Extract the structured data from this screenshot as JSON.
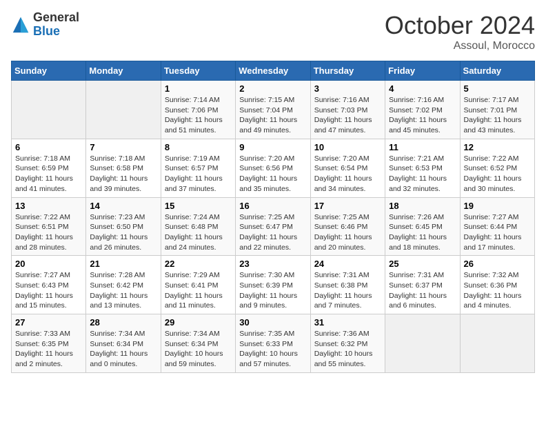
{
  "header": {
    "logo_general": "General",
    "logo_blue": "Blue",
    "month_title": "October 2024",
    "location": "Assoul, Morocco"
  },
  "weekdays": [
    "Sunday",
    "Monday",
    "Tuesday",
    "Wednesday",
    "Thursday",
    "Friday",
    "Saturday"
  ],
  "weeks": [
    [
      {
        "day": "",
        "info": ""
      },
      {
        "day": "",
        "info": ""
      },
      {
        "day": "1",
        "sunrise": "7:14 AM",
        "sunset": "7:06 PM",
        "daylight": "11 hours and 51 minutes."
      },
      {
        "day": "2",
        "sunrise": "7:15 AM",
        "sunset": "7:04 PM",
        "daylight": "11 hours and 49 minutes."
      },
      {
        "day": "3",
        "sunrise": "7:16 AM",
        "sunset": "7:03 PM",
        "daylight": "11 hours and 47 minutes."
      },
      {
        "day": "4",
        "sunrise": "7:16 AM",
        "sunset": "7:02 PM",
        "daylight": "11 hours and 45 minutes."
      },
      {
        "day": "5",
        "sunrise": "7:17 AM",
        "sunset": "7:01 PM",
        "daylight": "11 hours and 43 minutes."
      }
    ],
    [
      {
        "day": "6",
        "sunrise": "7:18 AM",
        "sunset": "6:59 PM",
        "daylight": "11 hours and 41 minutes."
      },
      {
        "day": "7",
        "sunrise": "7:18 AM",
        "sunset": "6:58 PM",
        "daylight": "11 hours and 39 minutes."
      },
      {
        "day": "8",
        "sunrise": "7:19 AM",
        "sunset": "6:57 PM",
        "daylight": "11 hours and 37 minutes."
      },
      {
        "day": "9",
        "sunrise": "7:20 AM",
        "sunset": "6:56 PM",
        "daylight": "11 hours and 35 minutes."
      },
      {
        "day": "10",
        "sunrise": "7:20 AM",
        "sunset": "6:54 PM",
        "daylight": "11 hours and 34 minutes."
      },
      {
        "day": "11",
        "sunrise": "7:21 AM",
        "sunset": "6:53 PM",
        "daylight": "11 hours and 32 minutes."
      },
      {
        "day": "12",
        "sunrise": "7:22 AM",
        "sunset": "6:52 PM",
        "daylight": "11 hours and 30 minutes."
      }
    ],
    [
      {
        "day": "13",
        "sunrise": "7:22 AM",
        "sunset": "6:51 PM",
        "daylight": "11 hours and 28 minutes."
      },
      {
        "day": "14",
        "sunrise": "7:23 AM",
        "sunset": "6:50 PM",
        "daylight": "11 hours and 26 minutes."
      },
      {
        "day": "15",
        "sunrise": "7:24 AM",
        "sunset": "6:48 PM",
        "daylight": "11 hours and 24 minutes."
      },
      {
        "day": "16",
        "sunrise": "7:25 AM",
        "sunset": "6:47 PM",
        "daylight": "11 hours and 22 minutes."
      },
      {
        "day": "17",
        "sunrise": "7:25 AM",
        "sunset": "6:46 PM",
        "daylight": "11 hours and 20 minutes."
      },
      {
        "day": "18",
        "sunrise": "7:26 AM",
        "sunset": "6:45 PM",
        "daylight": "11 hours and 18 minutes."
      },
      {
        "day": "19",
        "sunrise": "7:27 AM",
        "sunset": "6:44 PM",
        "daylight": "11 hours and 17 minutes."
      }
    ],
    [
      {
        "day": "20",
        "sunrise": "7:27 AM",
        "sunset": "6:43 PM",
        "daylight": "11 hours and 15 minutes."
      },
      {
        "day": "21",
        "sunrise": "7:28 AM",
        "sunset": "6:42 PM",
        "daylight": "11 hours and 13 minutes."
      },
      {
        "day": "22",
        "sunrise": "7:29 AM",
        "sunset": "6:41 PM",
        "daylight": "11 hours and 11 minutes."
      },
      {
        "day": "23",
        "sunrise": "7:30 AM",
        "sunset": "6:39 PM",
        "daylight": "11 hours and 9 minutes."
      },
      {
        "day": "24",
        "sunrise": "7:31 AM",
        "sunset": "6:38 PM",
        "daylight": "11 hours and 7 minutes."
      },
      {
        "day": "25",
        "sunrise": "7:31 AM",
        "sunset": "6:37 PM",
        "daylight": "11 hours and 6 minutes."
      },
      {
        "day": "26",
        "sunrise": "7:32 AM",
        "sunset": "6:36 PM",
        "daylight": "11 hours and 4 minutes."
      }
    ],
    [
      {
        "day": "27",
        "sunrise": "7:33 AM",
        "sunset": "6:35 PM",
        "daylight": "11 hours and 2 minutes."
      },
      {
        "day": "28",
        "sunrise": "7:34 AM",
        "sunset": "6:34 PM",
        "daylight": "11 hours and 0 minutes."
      },
      {
        "day": "29",
        "sunrise": "7:34 AM",
        "sunset": "6:34 PM",
        "daylight": "10 hours and 59 minutes."
      },
      {
        "day": "30",
        "sunrise": "7:35 AM",
        "sunset": "6:33 PM",
        "daylight": "10 hours and 57 minutes."
      },
      {
        "day": "31",
        "sunrise": "7:36 AM",
        "sunset": "6:32 PM",
        "daylight": "10 hours and 55 minutes."
      },
      {
        "day": "",
        "info": ""
      },
      {
        "day": "",
        "info": ""
      }
    ]
  ]
}
